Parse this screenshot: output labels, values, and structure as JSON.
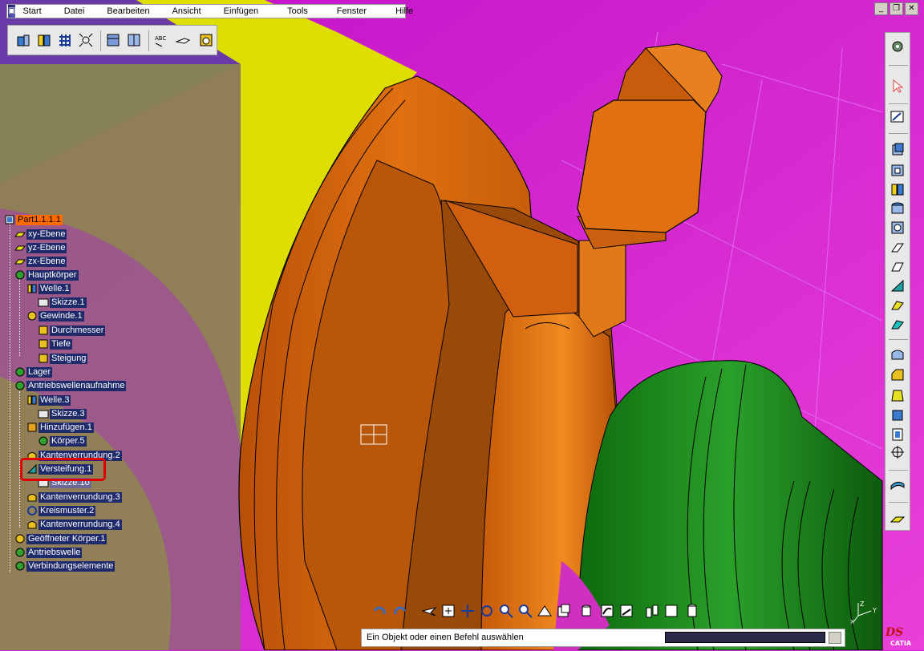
{
  "menu": {
    "items": [
      "Start",
      "Datei",
      "Bearbeiten",
      "Ansicht",
      "Einfügen",
      "Tools",
      "Fenster",
      "Hilfe"
    ]
  },
  "window": {
    "minimize_glyph": "_",
    "restore_glyph": "❐",
    "close_glyph": "✕"
  },
  "tree": {
    "nodes": [
      {
        "label": "Part1.1.1.1",
        "icon": "part-icon",
        "level": 0,
        "selected": true
      },
      {
        "label": "xy-Ebene",
        "icon": "plane-icon",
        "level": 1
      },
      {
        "label": "yz-Ebene",
        "icon": "plane-icon",
        "level": 1
      },
      {
        "label": "zx-Ebene",
        "icon": "plane-icon",
        "level": 1
      },
      {
        "label": "Hauptkörper",
        "icon": "body-icon",
        "level": 1
      },
      {
        "label": "Welle.1",
        "icon": "shaft-icon",
        "level": 2
      },
      {
        "label": "Skizze.1",
        "icon": "sketch-icon",
        "level": 3
      },
      {
        "label": "Gewinde.1",
        "icon": "thread-icon",
        "level": 2
      },
      {
        "label": "Durchmesser",
        "icon": "parameter-icon",
        "level": 3
      },
      {
        "label": "Tiefe",
        "icon": "parameter-icon",
        "level": 3
      },
      {
        "label": "Steigung",
        "icon": "parameter-icon",
        "level": 3
      },
      {
        "label": "Lager",
        "icon": "body-icon",
        "level": 1
      },
      {
        "label": "Antriebswellenaufnahme",
        "icon": "body-icon",
        "level": 1
      },
      {
        "label": "Welle.3",
        "icon": "shaft-icon",
        "level": 2
      },
      {
        "label": "Skizze.3",
        "icon": "sketch-icon",
        "level": 3
      },
      {
        "label": "Hinzufügen.1",
        "icon": "add-icon",
        "level": 2
      },
      {
        "label": "Körper.5",
        "icon": "body-icon",
        "level": 3
      },
      {
        "label": "Kantenverrundung.2",
        "icon": "fillet-icon",
        "level": 2
      },
      {
        "label": "Versteifung.1",
        "icon": "stiffener-icon",
        "level": 2
      },
      {
        "label": "Skizze.10",
        "icon": "sketch-icon",
        "level": 3
      },
      {
        "label": "Kantenverrundung.3",
        "icon": "fillet-icon",
        "level": 2
      },
      {
        "label": "Kreismuster.2",
        "icon": "pattern-icon",
        "level": 2
      },
      {
        "label": "Kantenverrundung.4",
        "icon": "fillet-icon",
        "level": 2
      },
      {
        "label": "Geöffneter Körper.1",
        "icon": "open-body-icon",
        "level": 1
      },
      {
        "label": "Antriebswelle",
        "icon": "body-icon",
        "level": 1
      },
      {
        "label": "Verbindungselemente",
        "icon": "body-icon",
        "level": 1
      }
    ]
  },
  "status": {
    "message": "Ein Objekt oder einen Befehl auswählen",
    "command_value": ""
  },
  "axis": {
    "z_label": "Z",
    "y_label": "Y",
    "x_label": "X"
  },
  "brand": {
    "logo_text": "CATIA",
    "logo_mark": "DS"
  },
  "colors": {
    "background": "#d020d8",
    "orange": "#e07010",
    "yellow": "#e0e000",
    "green": "#1a8a1a",
    "tree_label": "#1f2a6b",
    "highlight": "#ff6a00",
    "callout": "#e00000"
  }
}
